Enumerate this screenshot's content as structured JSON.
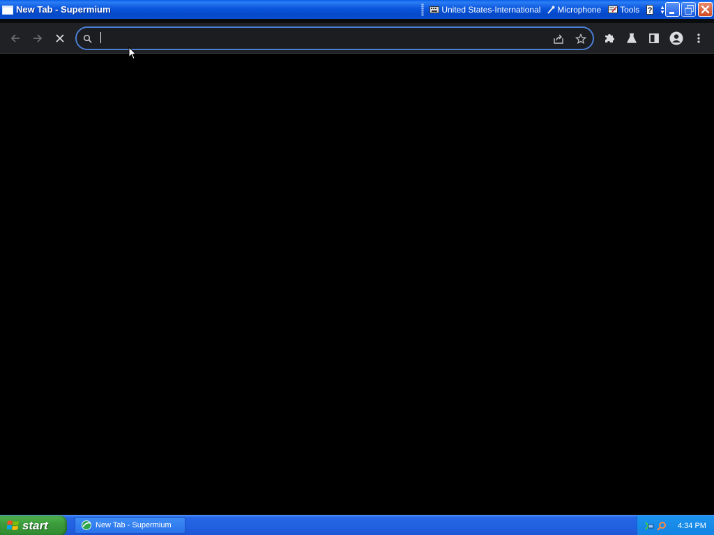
{
  "window": {
    "title": "New Tab - Supermium"
  },
  "language_bar": {
    "keyboard_layout": "United States-International",
    "microphone_label": "Microphone",
    "tools_label": "Tools",
    "help_label": "?"
  },
  "toolbar": {
    "back_icon": "arrow-left-icon",
    "forward_icon": "arrow-right-icon",
    "stop_icon": "close-icon",
    "extensions_icon": "puzzle-icon",
    "labs_icon": "flask-icon",
    "side_panel_icon": "side-panel-icon",
    "profile_icon": "avatar-icon",
    "menu_icon": "kebab-menu-icon"
  },
  "omnibox": {
    "value": "",
    "placeholder": "",
    "search_icon": "search-icon",
    "share_icon": "share-icon",
    "bookmark_icon": "star-icon"
  },
  "taskbar": {
    "start_label": "start",
    "task_label": "New Tab - Supermium",
    "clock": "4:34 PM"
  },
  "colors": {
    "toolbar_bg": "#1f2124",
    "omnibox_border": "#4b7fd6",
    "content_bg": "#000000",
    "xp_blue": "#0a56dc"
  }
}
